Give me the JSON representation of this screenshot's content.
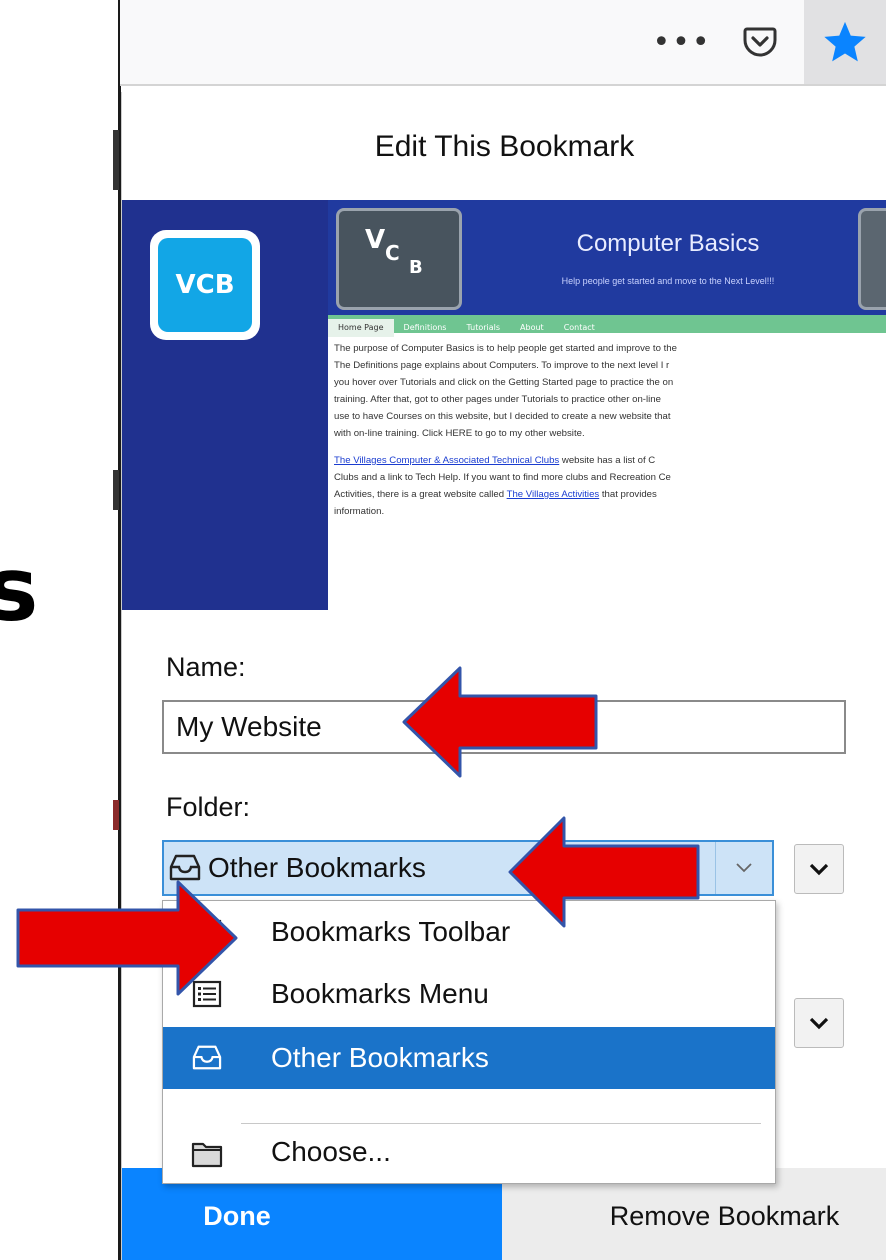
{
  "background": {
    "letter": "s"
  },
  "toolbar": {
    "more_icon": "ellipsis-icon",
    "pocket_icon": "pocket-icon",
    "star_icon": "bookmark-star-icon",
    "more_label": "•••"
  },
  "panel": {
    "title": "Edit This Bookmark"
  },
  "preview": {
    "logo_text": "VCB",
    "header_logo": {
      "v": "V",
      "c": "C",
      "b": "B"
    },
    "site_title": "Computer Basics",
    "tagline": "Help people get started and move to the Next Level!!!",
    "nav": [
      "Home Page",
      "Definitions",
      "Tutorials",
      "About",
      "Contact"
    ],
    "paragraph1": [
      "The purpose of Computer Basics is to help people get started and improve to the",
      "The Definitions page explains about Computers. To improve to the next level I r",
      "you hover over Tutorials and click on the Getting Started page to practice the on",
      "training. After that, got to other pages under Tutorials to practice other on-line",
      "use to have Courses on this website, but I decided to create a new website that",
      "with on-line training. Click HERE to go to my other website."
    ],
    "paragraph2": {
      "link1": "The Villages Computer & Associated Technical Clubs",
      "line1_rest": " website has a list of C",
      "line2": "Clubs and a link to Tech Help. If you want to find more clubs and Recreation Ce",
      "line3_pre": "Activities, there is a great website called ",
      "link2": "The Villages Activities",
      "line3_rest": " that provides",
      "line4": "information."
    }
  },
  "form": {
    "name_label": "Name:",
    "name_value": "My Website",
    "folder_label": "Folder:",
    "folder_selected": "Other Bookmarks"
  },
  "dropdown": {
    "items": [
      {
        "label": "Bookmarks Toolbar",
        "icon": "bookmarks-toolbar-icon",
        "selected": false
      },
      {
        "label": "Bookmarks Menu",
        "icon": "bookmarks-menu-icon",
        "selected": false
      },
      {
        "label": "Other Bookmarks",
        "icon": "other-bookmarks-icon",
        "selected": true
      },
      {
        "label": "Choose...",
        "icon": "folder-icon",
        "selected": false
      }
    ]
  },
  "footer": {
    "done_label": "Done",
    "remove_label": "Remove Bookmark"
  },
  "colors": {
    "accent": "#0a84ff",
    "selection": "#1a73c9",
    "annotation_arrow": "#e60000",
    "preview_bg": "#20318f"
  }
}
